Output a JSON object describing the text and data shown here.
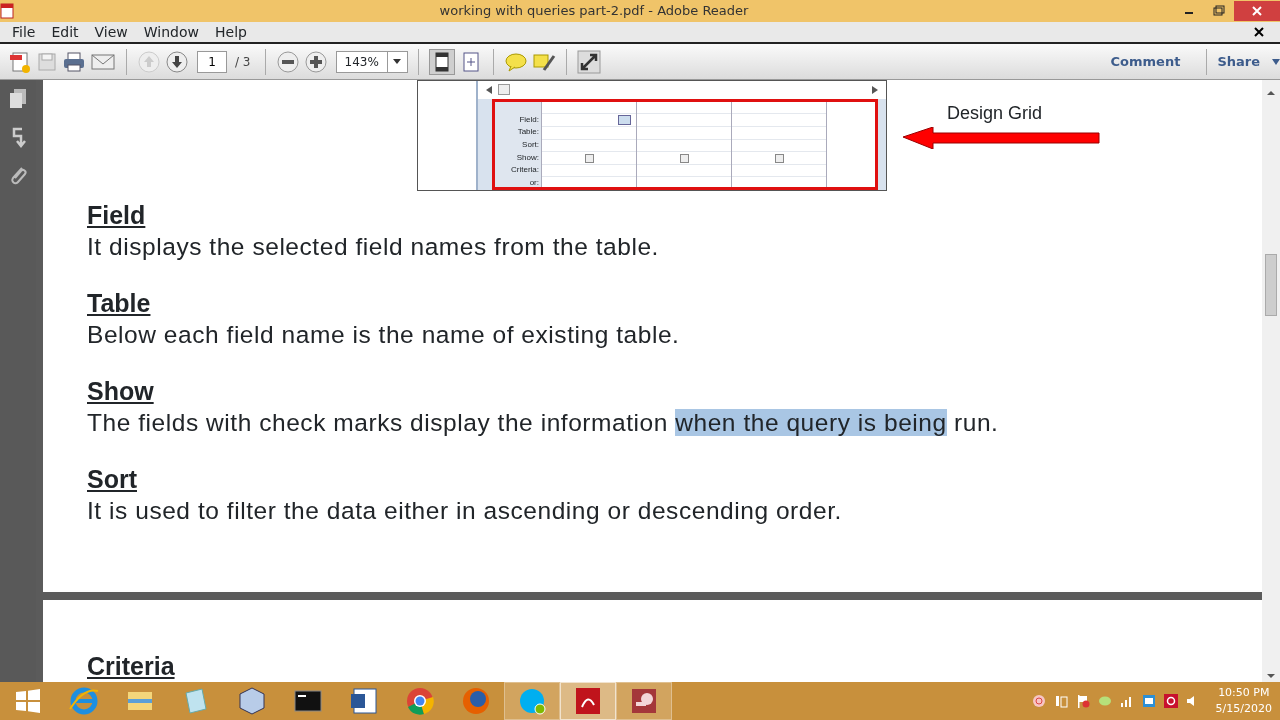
{
  "window": {
    "title": "working with queries part-2.pdf - Adobe Reader"
  },
  "menu": [
    "File",
    "Edit",
    "View",
    "Window",
    "Help"
  ],
  "toolbar": {
    "page": "1",
    "page_count": "/ 3",
    "zoom": "143%",
    "comment": "Comment",
    "share": "Share"
  },
  "figure": {
    "row_labels": [
      "Field:",
      "Table:",
      "Sort:",
      "Show:",
      "Criteria:",
      "or:"
    ],
    "show_boxes": [
      {
        "checked": false
      },
      {
        "checked": false
      },
      {
        "checked": false
      }
    ],
    "callout": "Design Grid"
  },
  "sections": [
    {
      "heading": "Field",
      "text": [
        {
          "text": "It displays the selected field names from the table.",
          "selected": false
        }
      ]
    },
    {
      "heading": "Table",
      "text": [
        {
          "text": "Below each field name is the name of existing table.",
          "selected": false
        }
      ]
    },
    {
      "heading": "Show",
      "text": [
        {
          "text": "The fields with check marks display the information ",
          "selected": false
        },
        {
          "text": "when the query is being",
          "selected": true
        },
        {
          "text": " run.",
          "selected": false
        }
      ]
    },
    {
      "heading": "Sort",
      "text": [
        {
          "text": "It is used to filter the data either in ascending or descending order.",
          "selected": false
        }
      ]
    }
  ],
  "next_page": {
    "heading": "Criteria"
  },
  "taskbar": {
    "apps": [
      {
        "kind": "ie",
        "selected": false,
        "running": false
      },
      {
        "kind": "explorer",
        "selected": false,
        "running": false
      },
      {
        "kind": "notepad",
        "selected": false,
        "running": false
      },
      {
        "kind": "cube",
        "selected": false,
        "running": false
      },
      {
        "kind": "cmd",
        "selected": false,
        "running": false
      },
      {
        "kind": "word",
        "selected": false,
        "running": false
      },
      {
        "kind": "chrome",
        "selected": false,
        "running": false
      },
      {
        "kind": "firefox",
        "selected": false,
        "running": false
      },
      {
        "kind": "skype",
        "selected": false,
        "running": true
      },
      {
        "kind": "acrobat",
        "selected": true,
        "running": true
      },
      {
        "kind": "access",
        "selected": false,
        "running": true
      }
    ],
    "clock": {
      "time": "10:50 PM",
      "date": "5/15/2020"
    }
  }
}
